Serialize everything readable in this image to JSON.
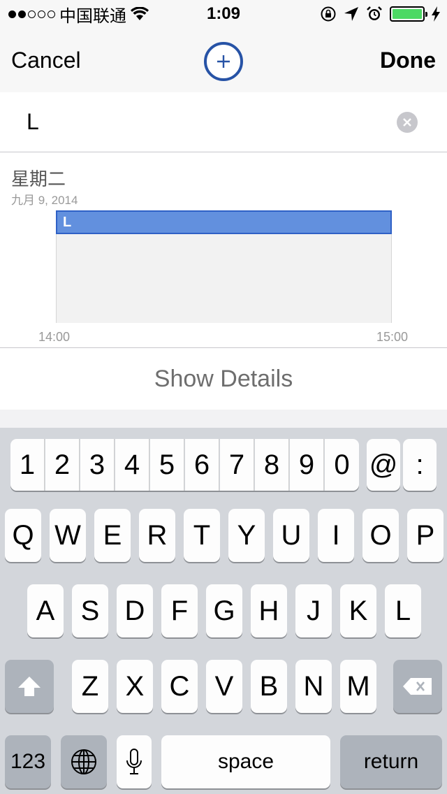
{
  "status_bar": {
    "carrier": "中国联通",
    "time": "1:09",
    "signal_dots": [
      true,
      true,
      false,
      false,
      false
    ],
    "battery_level": 1.0
  },
  "nav": {
    "cancel_label": "Cancel",
    "done_label": "Done",
    "add_icon": "plus-circle-icon"
  },
  "title_field": {
    "value": "L"
  },
  "day_view": {
    "weekday": "星期二",
    "date": "九月 9, 2014",
    "event_title": "L",
    "start_time": "14:00",
    "end_time": "15:00"
  },
  "show_details_label": "Show Details",
  "keyboard": {
    "number_row": [
      "1",
      "2",
      "3",
      "4",
      "5",
      "6",
      "7",
      "8",
      "9",
      "0"
    ],
    "at_key": "@",
    "colon_key": ":",
    "row1": [
      "Q",
      "W",
      "E",
      "R",
      "T",
      "Y",
      "U",
      "I",
      "O",
      "P"
    ],
    "row2": [
      "A",
      "S",
      "D",
      "F",
      "G",
      "H",
      "J",
      "K",
      "L"
    ],
    "row3": [
      "Z",
      "X",
      "C",
      "V",
      "B",
      "N",
      "M"
    ],
    "mode_key": "123",
    "space_key": "space",
    "return_key": "return"
  },
  "colors": {
    "accent": "#2753a6",
    "event_fill": "#6290de",
    "battery": "#4cd964"
  }
}
